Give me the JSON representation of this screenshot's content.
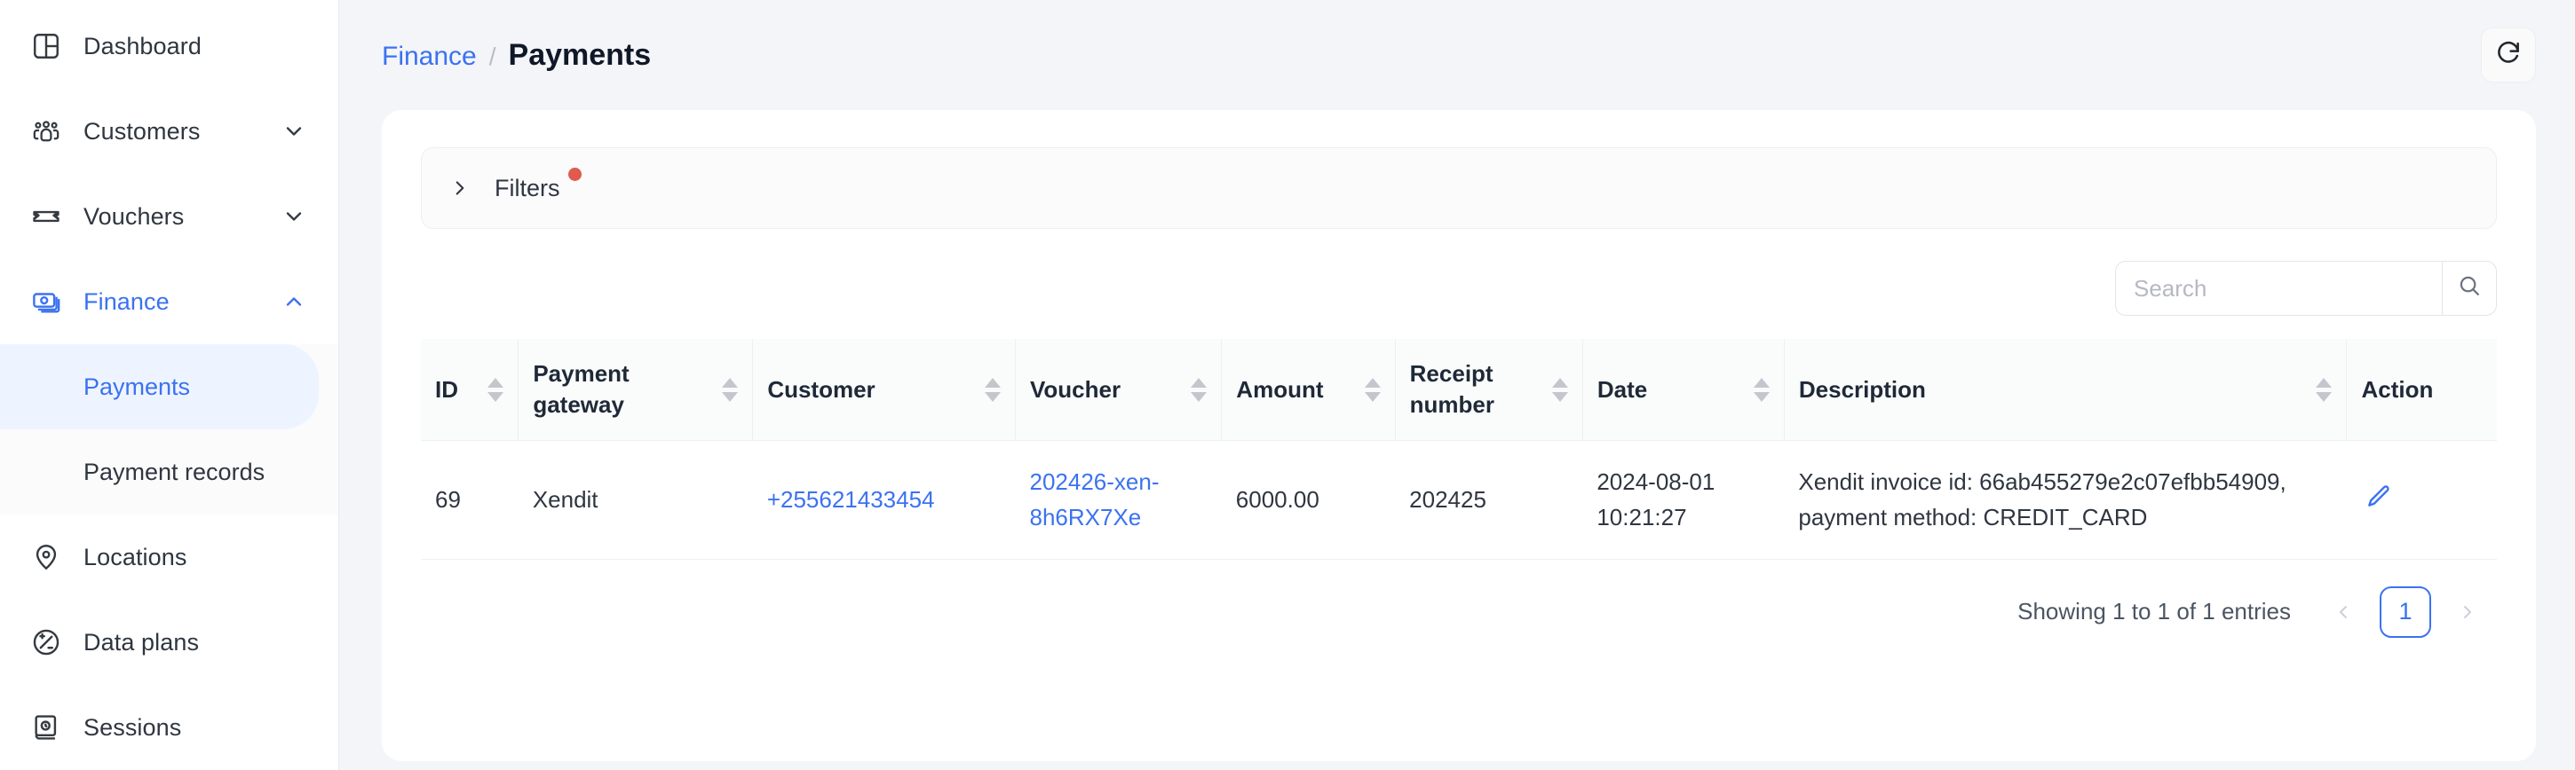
{
  "sidebar": {
    "items": [
      {
        "label": "Dashboard",
        "icon": "dashboard-icon",
        "expandable": false,
        "active": false
      },
      {
        "label": "Customers",
        "icon": "users-icon",
        "expandable": true,
        "active": false,
        "chevron": "chevron-down-icon"
      },
      {
        "label": "Vouchers",
        "icon": "ticket-icon",
        "expandable": true,
        "active": false,
        "chevron": "chevron-down-icon"
      },
      {
        "label": "Finance",
        "icon": "money-icon",
        "expandable": true,
        "active": true,
        "chevron": "chevron-up-icon"
      }
    ],
    "finance_children": [
      {
        "label": "Payments",
        "selected": true
      },
      {
        "label": "Payment records",
        "selected": false
      }
    ],
    "items_after": [
      {
        "label": "Locations",
        "icon": "map-pin-icon",
        "expandable": false,
        "active": false
      },
      {
        "label": "Data plans",
        "icon": "data-plan-icon",
        "expandable": false,
        "active": false
      },
      {
        "label": "Sessions",
        "icon": "sessions-icon",
        "expandable": false,
        "active": false
      }
    ],
    "active_color": "#3b72f0",
    "active_bg": "#eef4ff"
  },
  "header": {
    "breadcrumb_parent": "Finance",
    "breadcrumb_separator": "/",
    "breadcrumb_current": "Payments",
    "refresh_icon": "refresh-icon"
  },
  "filters": {
    "label": "Filters",
    "expand_icon": "chevron-right-icon",
    "has_active_filters": true,
    "dot_color": "#e05a4f"
  },
  "search": {
    "placeholder": "Search",
    "value": "",
    "button_icon": "search-icon"
  },
  "table": {
    "columns": [
      {
        "label": "ID",
        "sortable": true,
        "align": "left"
      },
      {
        "label": "Payment gateway",
        "sortable": true,
        "align": "left"
      },
      {
        "label": "Customer",
        "sortable": true,
        "align": "left"
      },
      {
        "label": "Voucher",
        "sortable": true,
        "align": "left"
      },
      {
        "label": "Amount",
        "sortable": true,
        "align": "left"
      },
      {
        "label": "Receipt number",
        "sortable": true,
        "align": "left"
      },
      {
        "label": "Date",
        "sortable": true,
        "align": "left"
      },
      {
        "label": "Description",
        "sortable": true,
        "align": "left"
      },
      {
        "label": "Action",
        "sortable": false,
        "align": "left"
      }
    ],
    "rows": [
      {
        "id": "69",
        "payment_gateway": "Xendit",
        "customer": "+255621433454",
        "voucher": "202426-xen-8h6RX7Xe",
        "amount": "6000.00",
        "receipt_number": "202425",
        "date": "2024-08-01 10:21:27",
        "description": "Xendit invoice id: 66ab455279e2c07efbb54909, payment method: CREDIT_CARD",
        "action_icon": "edit-pencil-icon"
      }
    ]
  },
  "footer": {
    "showing_text": "Showing 1 to 1 of 1 entries",
    "prev_icon": "chevron-left-icon",
    "next_icon": "chevron-right-icon",
    "current_page": "1"
  }
}
